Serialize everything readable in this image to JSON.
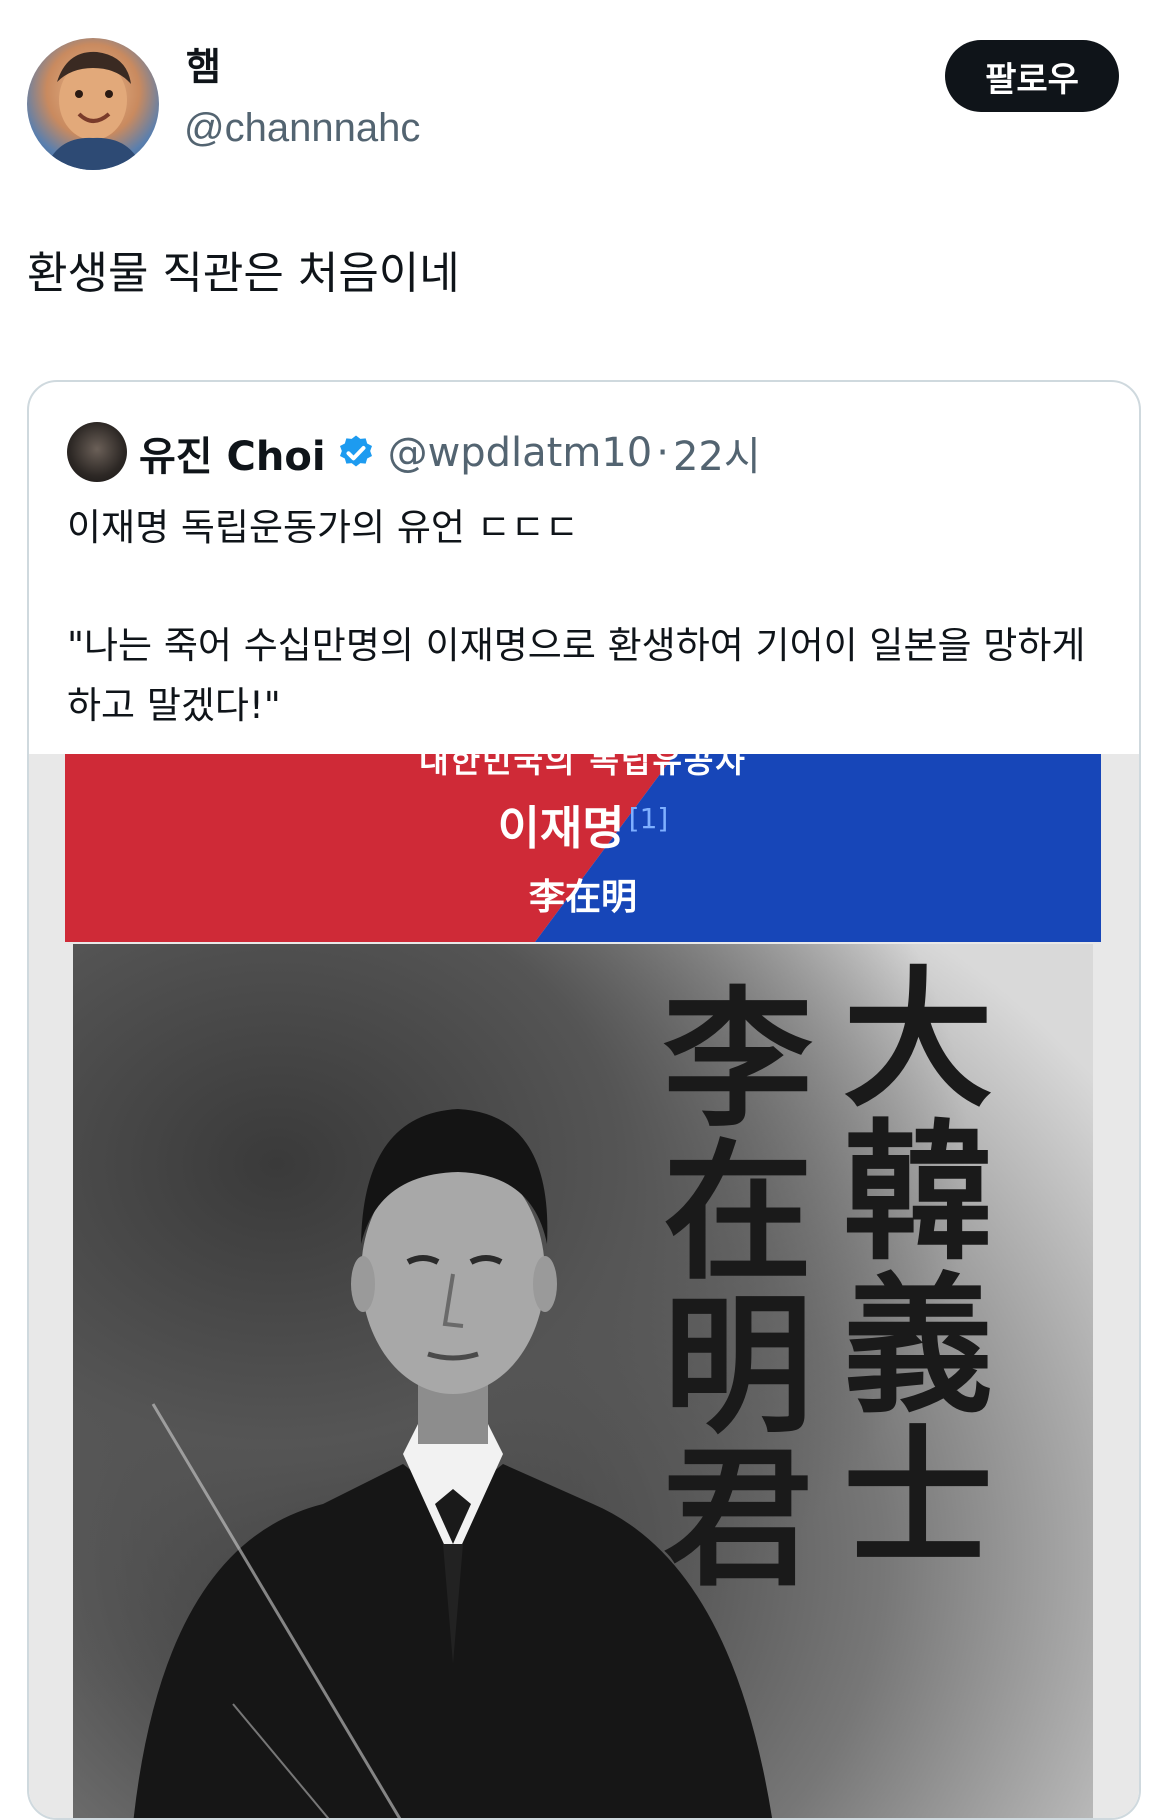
{
  "author": {
    "display_name": "햄",
    "handle": "@channnahc"
  },
  "follow_button_label": "팔로우",
  "tweet_text": "환생물 직관은 처음이네",
  "quote": {
    "display_name": "유진 Choi",
    "handle": "@wpdlatm10",
    "separator": "·",
    "time": "22시",
    "text": "이재명 독립운동가의 유언 ㄷㄷㄷ\n\n\"나는 죽어 수십만명의 이재명으로 환생하여 기어이 일본을 망하게 하고 말겠다!\"",
    "image": {
      "banner_cut_text": "대한민국의 독립유공자",
      "banner_title": "이재명",
      "banner_footnote": "[1]",
      "banner_hanja": "李在明",
      "calligraphy_right": "大韓義士",
      "calligraphy_left": "李在明君"
    }
  },
  "colors": {
    "follow_bg": "#0f1419",
    "secondary_text": "#536471",
    "verified": "#1d9bf0",
    "banner_red": "#cf2a37",
    "banner_blue": "#1746b8"
  }
}
